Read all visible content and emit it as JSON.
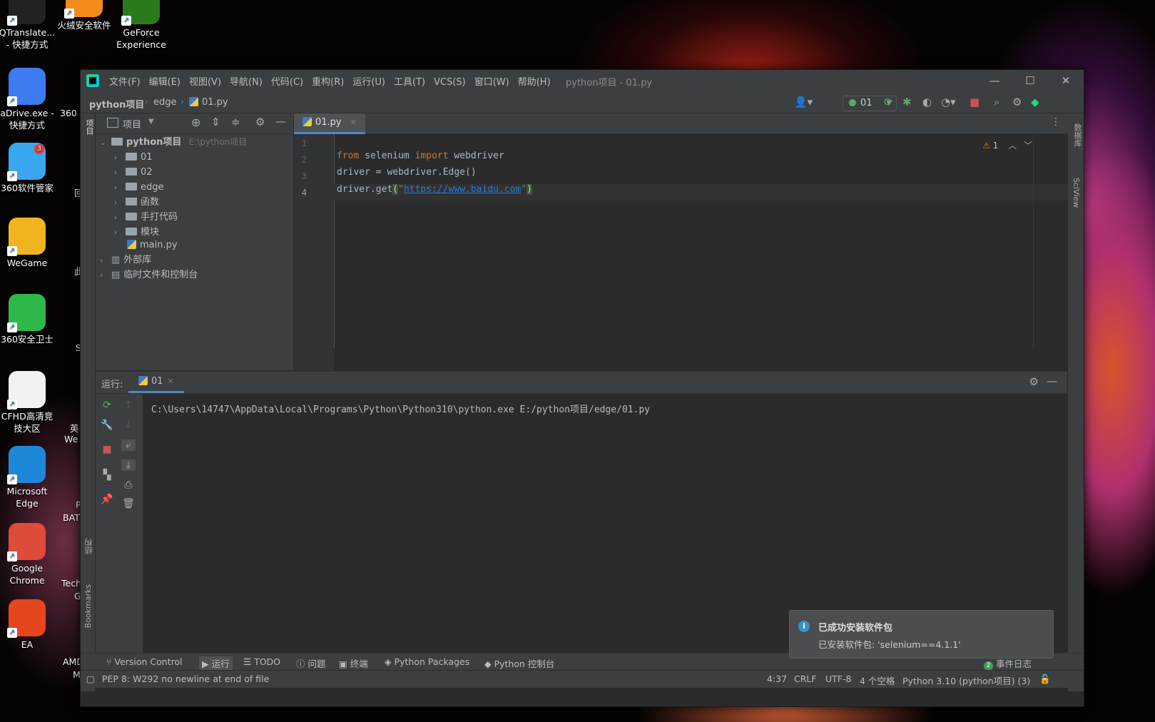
{
  "desktop": {
    "icons": [
      {
        "label": "QTranslate... - 快捷方式",
        "color": "#222222"
      },
      {
        "label": "火绒安全软件",
        "color": "#f28c1a"
      },
      {
        "label": "GeForce Experience",
        "color": "#2a7a1c"
      },
      {
        "label": "aDrive.exe - 快捷方式",
        "color": "#3d7bf0"
      },
      {
        "label": "360软件管家",
        "color": "#3aa6f0",
        "badge": "3"
      },
      {
        "label": "WeGame",
        "color": "#f1b421"
      },
      {
        "label": "360安全卫士",
        "color": "#2fb84a"
      },
      {
        "label": "CFHD高清竞技大区",
        "color": "#f2f2f2"
      },
      {
        "label": "Microsoft Edge",
        "color": "#1e88d8"
      },
      {
        "label": "Google Chrome",
        "color": "#dd4b39"
      },
      {
        "label": "EA",
        "color": "#e5461e"
      }
    ],
    "partial_labels": [
      "360",
      "回",
      "此",
      "S",
      "英",
      "We",
      "P",
      "BAT",
      "Tech",
      "G",
      "AMD",
      "M"
    ]
  },
  "window": {
    "menu": [
      "文件(F)",
      "编辑(E)",
      "视图(V)",
      "导航(N)",
      "代码(C)",
      "重构(R)",
      "运行(U)",
      "工具(T)",
      "VCS(S)",
      "窗口(W)",
      "帮助(H)"
    ],
    "title": "python项目 - 01.py",
    "controls": {
      "minimize": "—",
      "maximize": "☐",
      "close": "✕"
    }
  },
  "navbar": {
    "breadcrumb": [
      "python项目",
      "edge",
      "01.py"
    ],
    "run_config": "01"
  },
  "left_strip": {
    "project_label": "项目",
    "structure_label": "结构",
    "bookmarks_label": "Bookmarks"
  },
  "right_strip": {
    "database_label": "数据库",
    "sciview_label": "SciView"
  },
  "project_panel": {
    "header": "项目",
    "root": {
      "name": "python项目",
      "path": "E:\\python项目"
    },
    "children": [
      "01",
      "02",
      "edge",
      "函数",
      "手打代码",
      "模块"
    ],
    "file": "main.py",
    "external": "外部库",
    "scratches": "临时文件和控制台"
  },
  "editor": {
    "tab": "01.py",
    "line_numbers": [
      "1",
      "2",
      "3",
      "4"
    ],
    "code": {
      "l2_kw1": "from",
      "l2_mod": " selenium ",
      "l2_kw2": "import",
      "l2_rest": " webdriver",
      "l3": "driver = webdriver.Edge()",
      "l4_pre": "driver.get",
      "l4_open": "(",
      "l4_q1": "\"",
      "l4_url": "https://www.baidu.com",
      "l4_q2": "\"",
      "l4_close": ")"
    },
    "warnings": "1"
  },
  "run_panel": {
    "label": "运行:",
    "tab": "01",
    "command": "C:\\Users\\14747\\AppData\\Local\\Programs\\Python\\Python310\\python.exe E:/python项目/edge/01.py"
  },
  "notification": {
    "title": "已成功安装软件包",
    "body": "已安装软件包: 'selenium==4.1.1'"
  },
  "bottom_tools": {
    "vcs": "Version Control",
    "run": "运行",
    "todo": "TODO",
    "problems": "问题",
    "terminal": "终端",
    "packages": "Python Packages",
    "console": "Python 控制台",
    "event_count": "2",
    "event_log": "事件日志"
  },
  "status": {
    "message": "PEP 8: W292 no newline at end of file",
    "position": "4:37",
    "line_sep": "CRLF",
    "encoding": "UTF-8",
    "indent": "4 个空格",
    "interpreter": "Python 3.10 (python项目) (3)"
  },
  "colors": {
    "accent": "#4a88c7",
    "keyword": "#cc7832",
    "string": "#6a8759",
    "link": "#287bde"
  }
}
